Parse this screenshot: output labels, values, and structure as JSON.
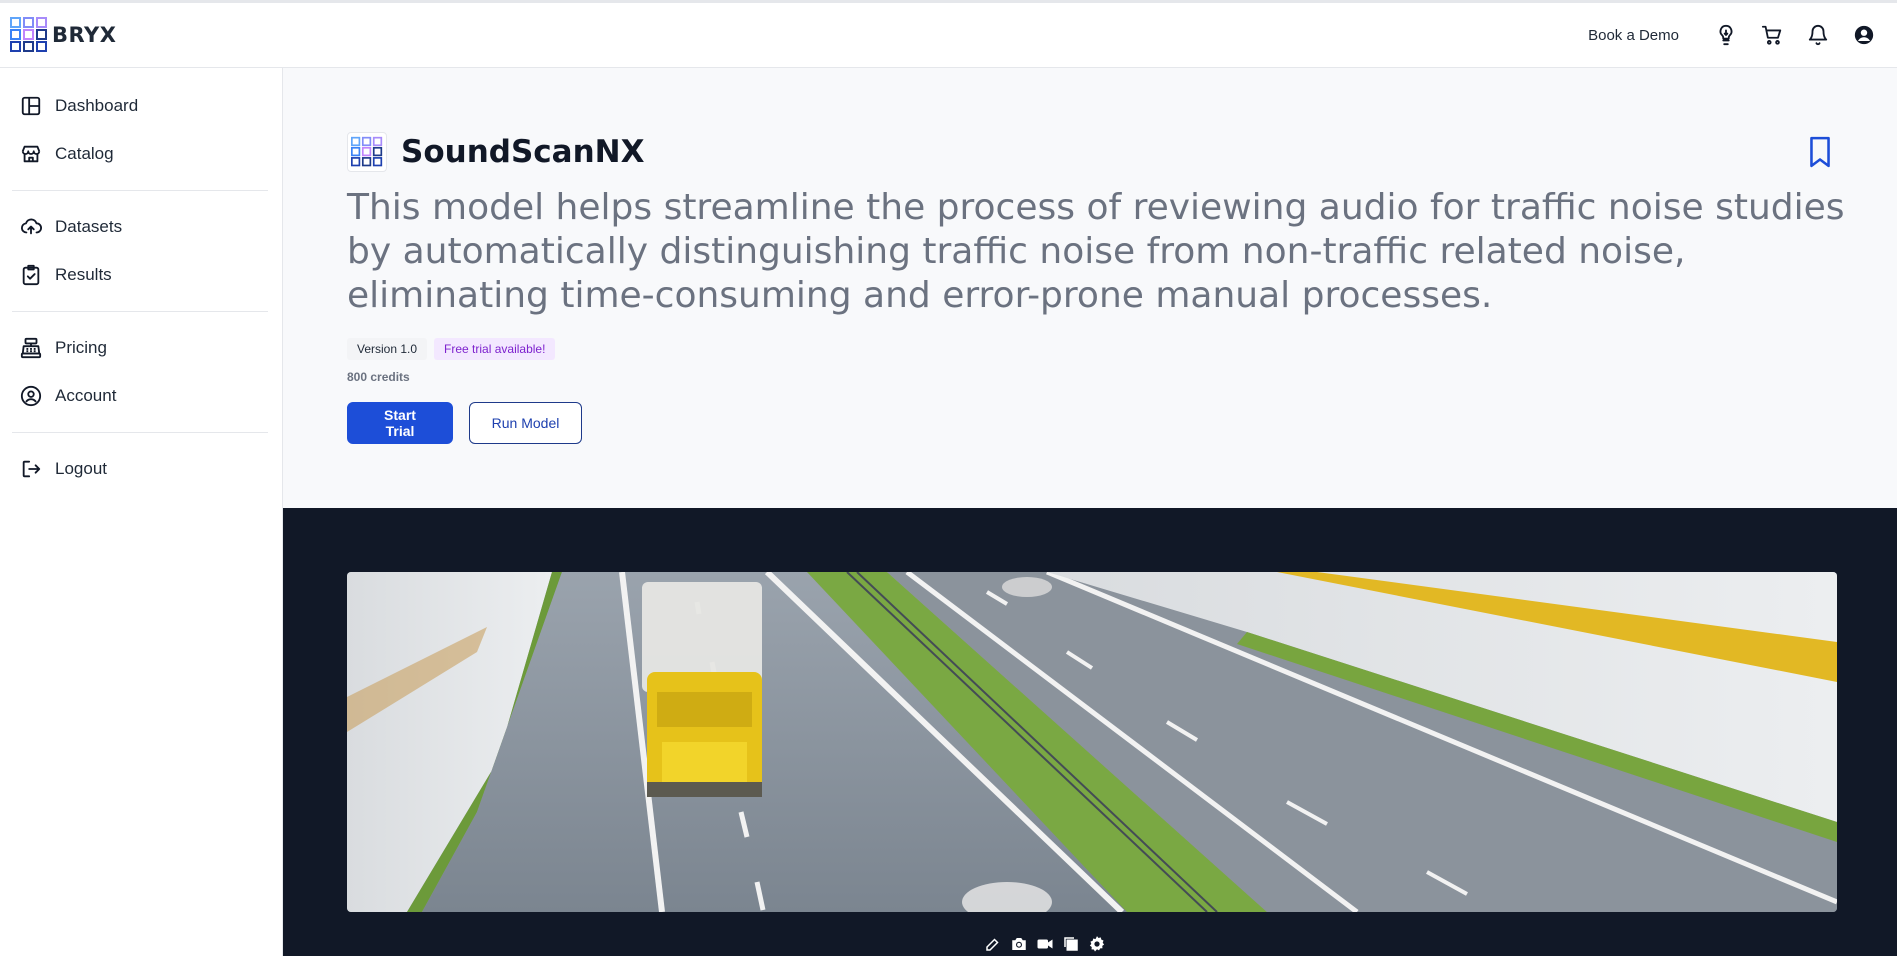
{
  "brand": {
    "name": "BRYX"
  },
  "topbar": {
    "book_demo": "Book a Demo",
    "icons": [
      "lightbulb-icon",
      "cart-icon",
      "bell-icon",
      "user-circle-icon"
    ]
  },
  "sidebar": {
    "items": [
      {
        "label": "Dashboard",
        "icon": "dashboard-icon"
      },
      {
        "label": "Catalog",
        "icon": "store-icon"
      },
      {
        "label": "Datasets",
        "icon": "cloud-upload-icon"
      },
      {
        "label": "Results",
        "icon": "clipboard-check-icon"
      },
      {
        "label": "Pricing",
        "icon": "cash-register-icon"
      },
      {
        "label": "Account",
        "icon": "user-circle-icon"
      },
      {
        "label": "Logout",
        "icon": "logout-icon"
      }
    ]
  },
  "model": {
    "title": "SoundScanNX",
    "description": "This model helps streamline the process of reviewing audio for traffic noise studies by automatically distinguishing traffic noise from non-traffic related noise, eliminating time-consuming and error-prone manual processes.",
    "version_badge": "Version 1.0",
    "trial_badge": "Free trial available!",
    "credits": "800 credits",
    "start_trial_label": "Start Trial",
    "run_model_label": "Run Model"
  },
  "media_toolbar": {
    "icons": [
      "edit-icon",
      "camera-icon",
      "video-icon",
      "copy-icon",
      "gear-icon"
    ]
  },
  "colors": {
    "primary": "#1d4ed8",
    "dark_section": "#111827",
    "trial_badge_text": "#7e22ce",
    "trial_badge_bg": "#f3e8ff"
  }
}
